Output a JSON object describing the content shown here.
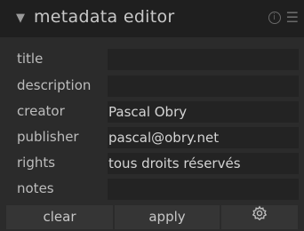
{
  "panel": {
    "title": "metadata editor",
    "collapse_icon": "triangle-down-icon",
    "info_icon": "info-icon",
    "info_glyph": "i",
    "menu_icon": "hamburger-menu-icon",
    "menu_glyph": "☰"
  },
  "fields": [
    {
      "label": "title",
      "value": ""
    },
    {
      "label": "description",
      "value": ""
    },
    {
      "label": "creator",
      "value": "Pascal Obry"
    },
    {
      "label": "publisher",
      "value": "pascal@obry.net"
    },
    {
      "label": "rights",
      "value": "tous droits réservés"
    },
    {
      "label": "notes",
      "value": ""
    }
  ],
  "buttons": {
    "clear_label": "clear",
    "apply_label": "apply",
    "settings_icon": "gear-icon"
  },
  "colors": {
    "background": "#2b2b2b",
    "header": "#1f1f1f",
    "field": "#232323",
    "button": "#353535"
  }
}
